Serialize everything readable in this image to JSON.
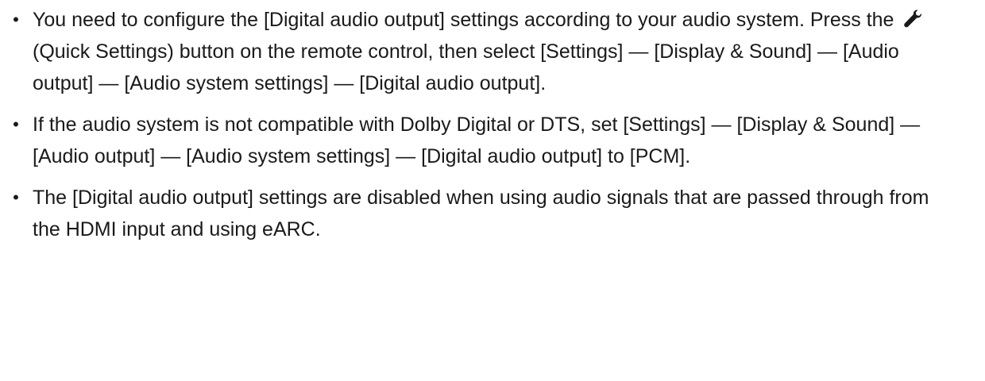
{
  "notes": {
    "items": [
      {
        "bullet": "•",
        "text_before_icon": "You need to configure the [Digital audio output] settings according to your audio system. Press the ",
        "icon": "wrench-icon",
        "text_after_icon": "(Quick Settings) button on the remote control, then select [Settings] — [Display & Sound] — [Audio output] — [Audio system settings] — [Digital audio output]."
      },
      {
        "bullet": "•",
        "text": "If the audio system is not compatible with Dolby Digital or DTS, set [Settings] — [Display & Sound] — [Audio output] — [Audio system settings] — [Digital audio output] to [PCM]."
      },
      {
        "bullet": "•",
        "text": "The [Digital audio output] settings are disabled when using audio signals that are passed through from the HDMI input and using eARC."
      }
    ]
  }
}
